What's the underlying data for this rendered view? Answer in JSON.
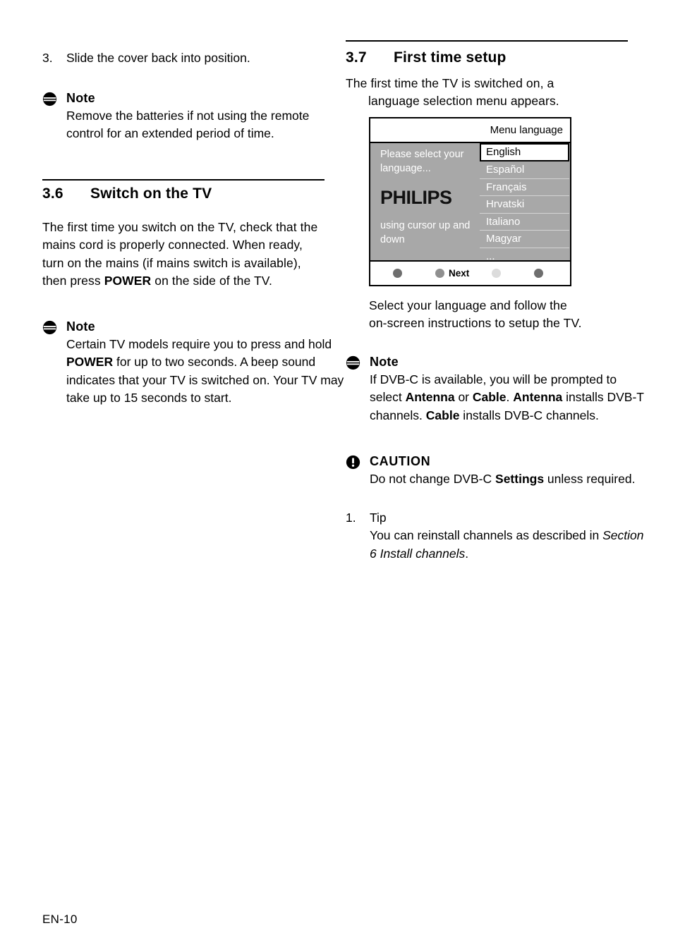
{
  "document": {
    "footer_label": "EN-10"
  },
  "left_column": {
    "step3": {
      "number": "3.",
      "text": "Slide the cover back into position."
    },
    "note1": {
      "icon": "note-icon",
      "title": "Note",
      "body": "Remove the batteries if not using the remote control for an extended period of time."
    },
    "section": {
      "number": "3.6",
      "title": "Switch on the TV",
      "body_part1": "The first time you switch on the TV, check that the mains cord is properly connected. When ready, turn on the mains (if mains switch is available), then press ",
      "body_bold": "POWER",
      "body_part2": " on the side of the TV."
    },
    "note2": {
      "icon": "note-icon",
      "title": "Note",
      "body_part1": "Certain TV models require you to press and hold ",
      "body_bold": "POWER",
      "body_part2": " for up to two seconds. A beep sound indicates that your TV is switched on. Your TV may take up to 15 seconds to start."
    }
  },
  "right_column": {
    "section": {
      "number": "3.7",
      "title": "First time setup",
      "intro_line1": "The first time the TV is switched on, a",
      "intro_line2": "language selection menu appears."
    },
    "tv_figure": {
      "header_title": "Menu language",
      "hint_top_line1": "Please select your",
      "hint_top_line2": "language...",
      "brand_logo": "PHILIPS",
      "hint_bottom_line1": "using cursor up and",
      "hint_bottom_line2": "down",
      "languages": [
        {
          "label": "English",
          "selected": true
        },
        {
          "label": "Español",
          "selected": false
        },
        {
          "label": "Français",
          "selected": false
        },
        {
          "label": "Hrvatski",
          "selected": false
        },
        {
          "label": "Italiano",
          "selected": false
        },
        {
          "label": "Magyar",
          "selected": false
        },
        {
          "label": "...",
          "selected": false
        }
      ],
      "footer_buttons": [
        {
          "name": "red-button",
          "label": "",
          "color": "#6e6e6e"
        },
        {
          "name": "green-button",
          "label": "Next",
          "color": "#8f8f8f"
        },
        {
          "name": "yellow-button",
          "label": "",
          "color": "#dcdcdc"
        },
        {
          "name": "blue-button",
          "label": "",
          "color": "#6e6e6e"
        }
      ]
    },
    "caption_line1": "Select your language and follow the",
    "caption_line2": "on-screen instructions to setup the TV.",
    "note": {
      "icon": "note-icon",
      "title": "Note",
      "body_1": "If DVB-C is available, you will be prompted to select ",
      "body_b1": "Antenna",
      "body_2": " or ",
      "body_b2": "Cable",
      "body_3": ". ",
      "body_b3": "Antenna",
      "body_4": " installs DVB-T channels. ",
      "body_b4": "Cable",
      "body_5": " installs DVB-C channels."
    },
    "caution": {
      "icon": "caution-icon",
      "title": "CAUTION",
      "body_1": "Do not change DVB-C ",
      "body_b1": "Settings",
      "body_2": " unless required."
    },
    "tip": {
      "number": "1.",
      "title": "Tip",
      "body": "You can reinstall channels as described in ",
      "body_italic": "Section 6 Install channels",
      "body_end": "."
    }
  },
  "colors": {
    "tv_background": "#a8a8a8",
    "tv_text": "#ffffff",
    "rule": "#000000"
  }
}
